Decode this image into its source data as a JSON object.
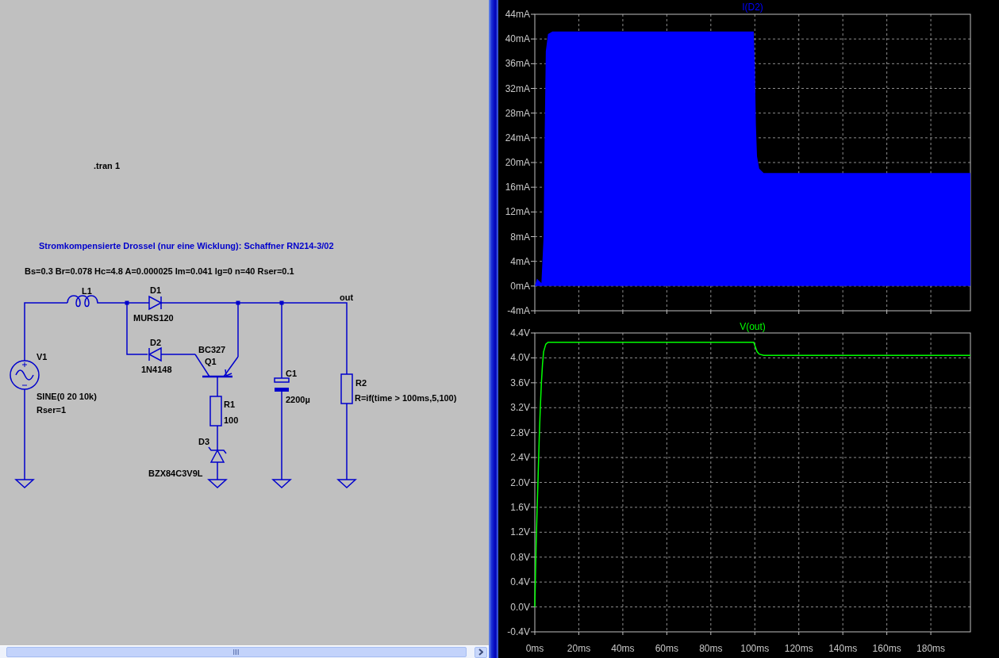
{
  "schematic": {
    "directive": ".tran 1",
    "title": "Stromkompensierte Drossel (nur eine Wicklung): Schaffner RN214-3/02",
    "params": "Bs=0.3 Br=0.078 Hc=4.8 A=0.000025 Im=0.041 lg=0 n=40 Rser=0.1",
    "net_label": "out",
    "components": [
      {
        "kind": "inductor",
        "ref": "L1"
      },
      {
        "kind": "diode",
        "ref": "D1",
        "value": "MURS120"
      },
      {
        "kind": "diode",
        "ref": "D2",
        "value": "1N4148"
      },
      {
        "kind": "source",
        "ref": "V1",
        "value": "SINE(0 20 10k)",
        "value_2": "Rser=1"
      },
      {
        "kind": "pnp",
        "ref": "Q1",
        "value": "BC327"
      },
      {
        "kind": "resistor",
        "ref": "R1",
        "value": "100"
      },
      {
        "kind": "zener",
        "ref": "D3",
        "value": "BZX84C3V9L"
      },
      {
        "kind": "capacitor",
        "ref": "C1",
        "value": "2200µ"
      },
      {
        "kind": "resistor",
        "ref": "R2",
        "value": "R=if(time > 100ms,5,100)"
      }
    ]
  },
  "plots": [
    {
      "chart_data": {
        "type": "area",
        "grid": true,
        "xlim": [
          0,
          198
        ],
        "ylim": [
          -4,
          44
        ],
        "x": [
          0,
          1,
          2,
          3,
          4,
          4.5,
          5,
          6,
          8,
          20,
          40,
          60,
          80,
          99.5,
          100,
          100.5,
          101,
          102,
          104,
          120,
          140,
          160,
          180,
          198
        ],
        "series": [
          {
            "name": "I(D2)",
            "color": "#0000ff",
            "values": [
              0,
              1.2,
              0.8,
              0.5,
              8,
              25,
              38,
              40.8,
              41.2,
              41.2,
              41.2,
              41.2,
              41.2,
              41.2,
              36,
              26,
              21,
              19,
              18.3,
              18.3,
              18.3,
              18.3,
              18.3,
              18.3
            ]
          }
        ],
        "yticks": [
          {
            "value": -4,
            "label": "-4mA"
          },
          {
            "value": 0,
            "label": "0mA"
          },
          {
            "value": 4,
            "label": "4mA"
          },
          {
            "value": 8,
            "label": "8mA"
          },
          {
            "value": 12,
            "label": "12mA"
          },
          {
            "value": 16,
            "label": "16mA"
          },
          {
            "value": 20,
            "label": "20mA"
          },
          {
            "value": 24,
            "label": "24mA"
          },
          {
            "value": 28,
            "label": "28mA"
          },
          {
            "value": 32,
            "label": "32mA"
          },
          {
            "value": 36,
            "label": "36mA"
          },
          {
            "value": 40,
            "label": "40mA"
          },
          {
            "value": 44,
            "label": "44mA"
          }
        ]
      }
    },
    {
      "chart_data": {
        "type": "line",
        "grid": true,
        "xlim": [
          0,
          198
        ],
        "ylim": [
          -0.4,
          4.4
        ],
        "x": [
          0,
          0.3,
          0.6,
          1,
          1.5,
          2,
          2.5,
          3,
          3.5,
          4,
          5,
          6,
          8,
          99.5,
          100,
          101,
          102,
          104,
          120,
          198
        ],
        "series": [
          {
            "name": "V(out)",
            "color": "#00ff00",
            "values": [
              0,
              0.5,
              1.0,
              1.5,
              2.1,
              2.7,
              3.2,
              3.6,
              3.9,
              4.1,
              4.22,
              4.25,
              4.25,
              4.25,
              4.2,
              4.1,
              4.06,
              4.04,
              4.04,
              4.04
            ]
          }
        ],
        "xticks": [
          {
            "value": 0,
            "label": "0ms"
          },
          {
            "value": 20,
            "label": "20ms"
          },
          {
            "value": 40,
            "label": "40ms"
          },
          {
            "value": 60,
            "label": "60ms"
          },
          {
            "value": 80,
            "label": "80ms"
          },
          {
            "value": 100,
            "label": "100ms"
          },
          {
            "value": 120,
            "label": "120ms"
          },
          {
            "value": 140,
            "label": "140ms"
          },
          {
            "value": 160,
            "label": "160ms"
          },
          {
            "value": 180,
            "label": "180ms"
          }
        ],
        "yticks": [
          {
            "value": -0.4,
            "label": "-0.4V"
          },
          {
            "value": 0,
            "label": "0.0V"
          },
          {
            "value": 0.4,
            "label": "0.4V"
          },
          {
            "value": 0.8,
            "label": "0.8V"
          },
          {
            "value": 1.2,
            "label": "1.2V"
          },
          {
            "value": 1.6,
            "label": "1.6V"
          },
          {
            "value": 2.0,
            "label": "2.0V"
          },
          {
            "value": 2.4,
            "label": "2.4V"
          },
          {
            "value": 2.8,
            "label": "2.8V"
          },
          {
            "value": 3.2,
            "label": "3.2V"
          },
          {
            "value": 3.6,
            "label": "3.6V"
          },
          {
            "value": 4.0,
            "label": "4.0V"
          },
          {
            "value": 4.4,
            "label": "4.4V"
          }
        ]
      }
    }
  ]
}
